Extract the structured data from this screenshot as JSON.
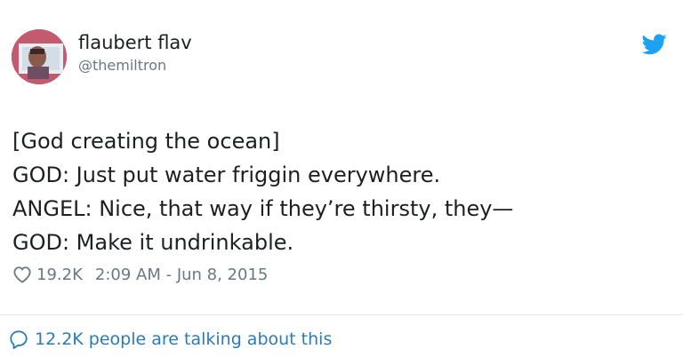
{
  "author": {
    "display_name": "flaubert flav",
    "handle": "@themiltron",
    "avatar": "profile-photo"
  },
  "tweet": {
    "lines": [
      "[God creating the ocean]",
      "GOD: Just put water friggin everywhere.",
      "ANGEL: Nice, that way if they’re thirsty, they—",
      "GOD: Make it undrinkable."
    ]
  },
  "meta": {
    "like_count": "19.2K",
    "timestamp": "2:09 AM - Jun 8, 2015"
  },
  "footer": {
    "talking_text": "12.2K people are talking about this"
  },
  "icons": {
    "brand": "twitter-bird-icon",
    "like": "heart-icon",
    "reply": "speech-bubble-icon"
  },
  "colors": {
    "brand_blue": "#1da1f2",
    "link_blue": "#2b7bb9",
    "text": "#1c2022",
    "muted": "#697882"
  }
}
